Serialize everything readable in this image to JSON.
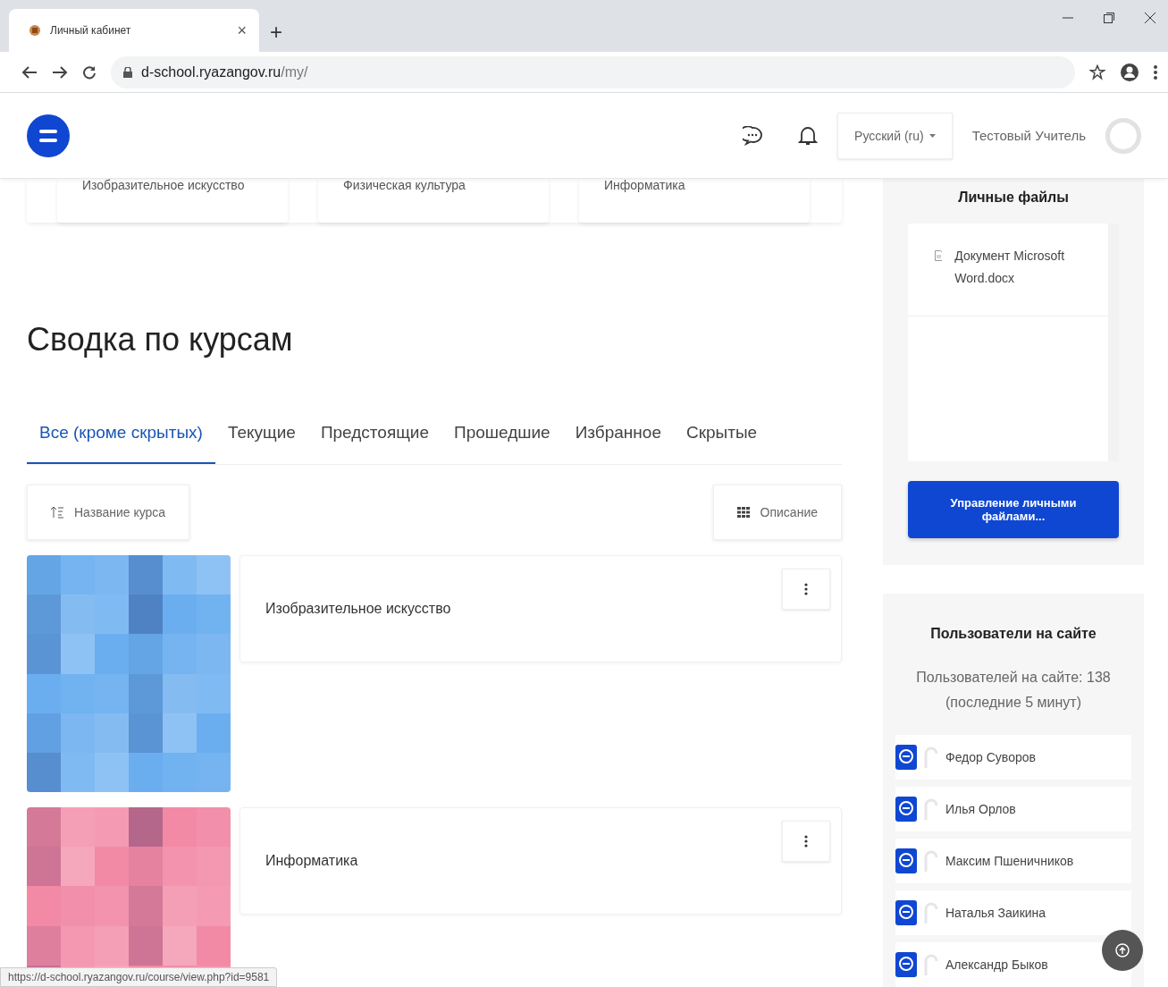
{
  "browser": {
    "tab_title": "Личный кабинет",
    "tab_close": "×",
    "new_tab": "+",
    "url_host": "d-school.ryazangov.ru",
    "url_path": "/my/"
  },
  "navbar": {
    "language": "Русский (ru)",
    "user": "Тестовый Учитель"
  },
  "recent_courses": [
    "Изобразительное искусство",
    "Физическая культура",
    "Информатика"
  ],
  "course_overview": {
    "title": "Сводка по курсам",
    "tabs": [
      {
        "label": "Все (кроме скрытых)",
        "selected": true
      },
      {
        "label": "Текущие",
        "selected": false
      },
      {
        "label": "Предстоящие",
        "selected": false
      },
      {
        "label": "Прошедшие",
        "selected": false
      },
      {
        "label": "Избранное",
        "selected": false
      },
      {
        "label": "Скрытые",
        "selected": false
      }
    ],
    "sort_button": "Название курса",
    "view_button": "Описание",
    "courses": [
      {
        "name": "Изобразительное искусство",
        "color": "#6aaef0"
      },
      {
        "name": "Информатика",
        "color": "#f28aa6"
      }
    ]
  },
  "sidebar": {
    "private_files": {
      "title": "Личные файлы",
      "files": [
        "Документ Microsoft Word.docx"
      ],
      "button": "Управление личными файлами..."
    },
    "online_users": {
      "title": "Пользователи на сайте",
      "summary": "Пользователей на сайте: 138",
      "period": "(последние 5 минут)",
      "users": [
        "Федор Суворов",
        "Илья Орлов",
        "Максим Пшеничников",
        "Наталья Заикина",
        "Александр Быков"
      ]
    }
  },
  "status_url": "https://d-school.ryazangov.ru/course/view.php?id=9581"
}
